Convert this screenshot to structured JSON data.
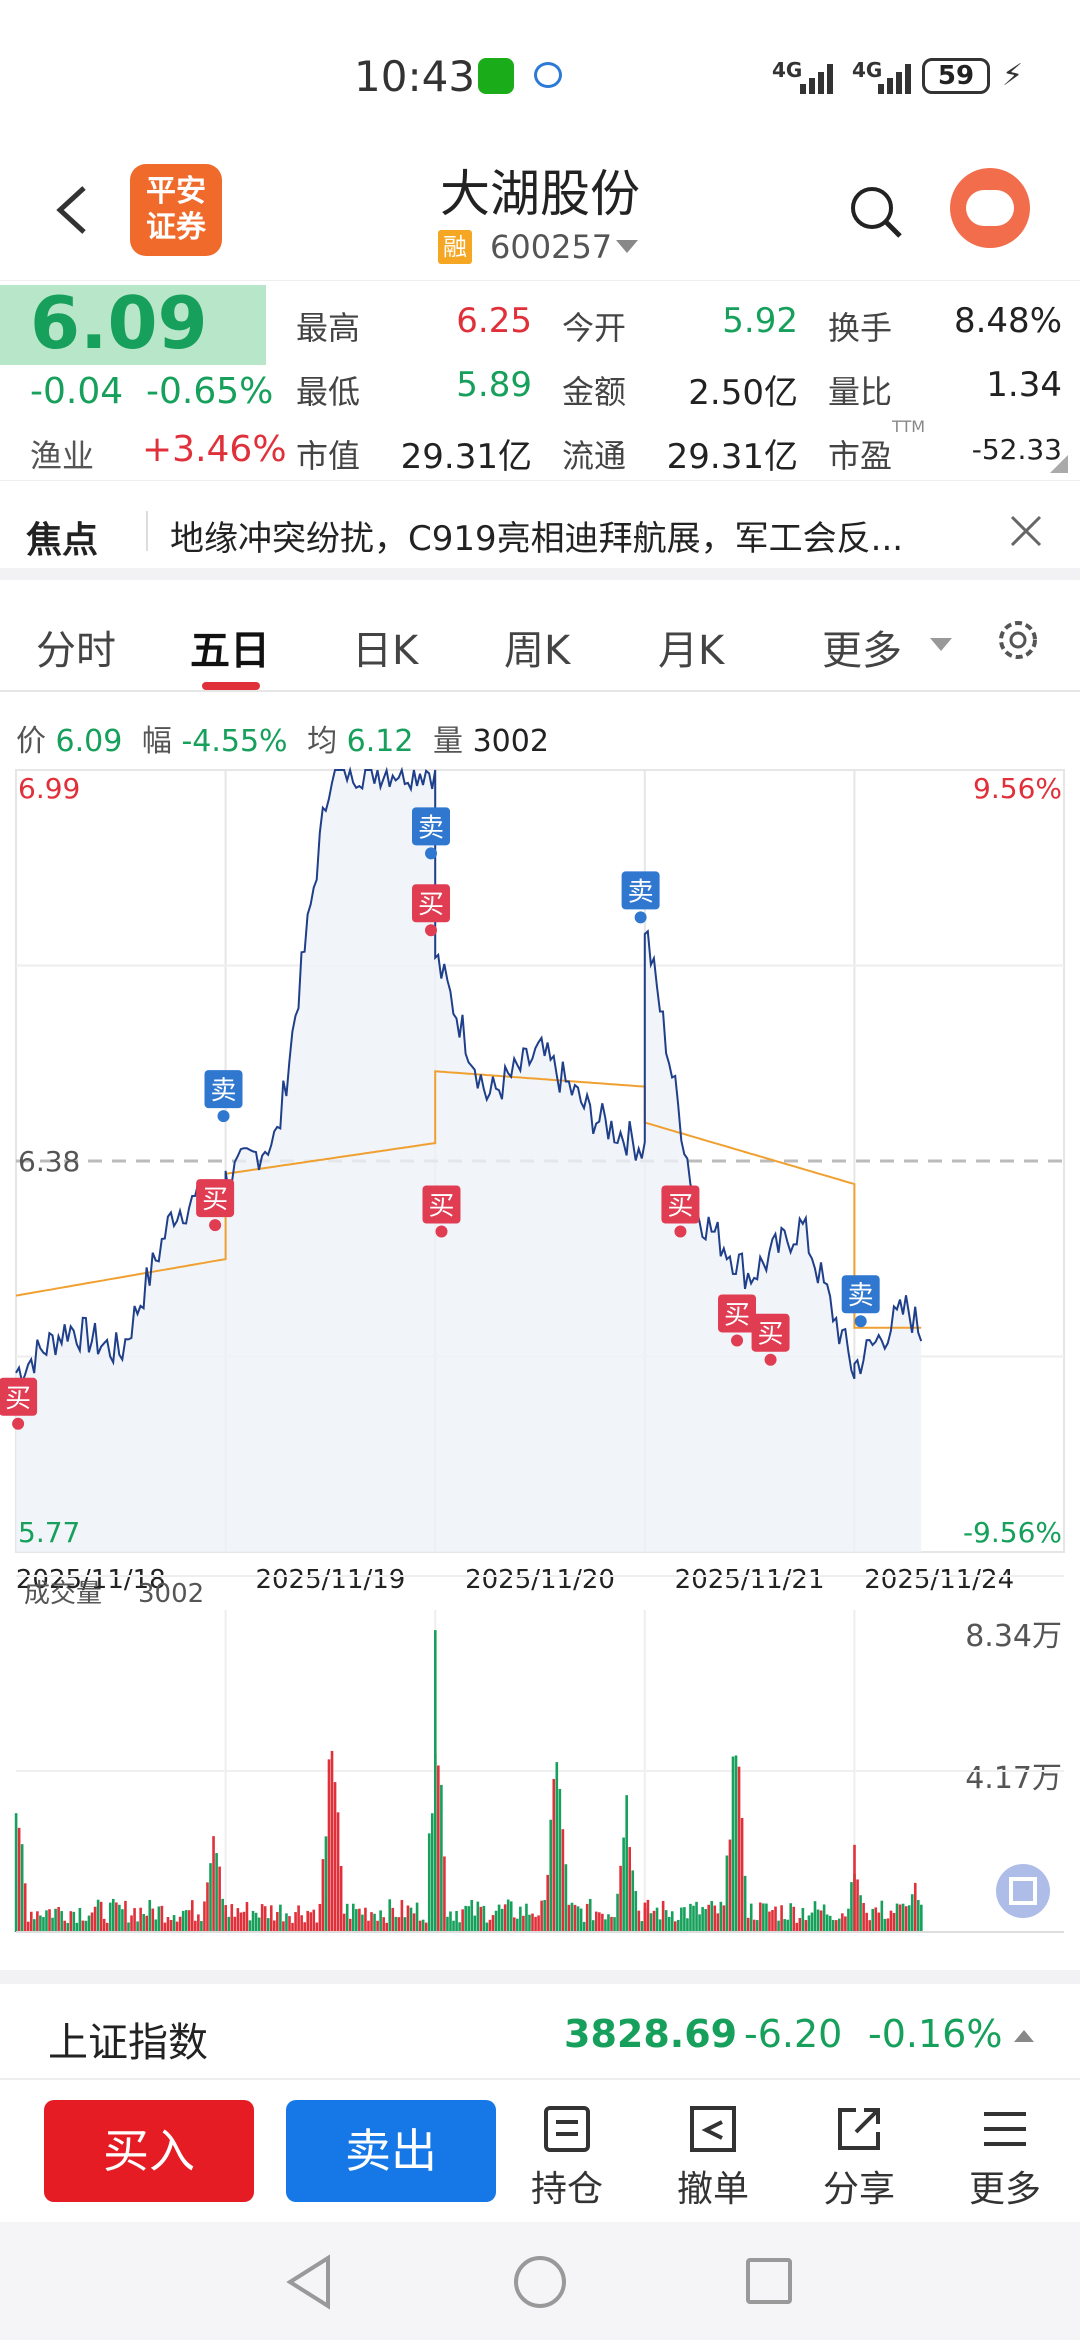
{
  "status_bar": {
    "time": "10:43",
    "battery": "59",
    "net1": "4G",
    "net2": "4G"
  },
  "header": {
    "broker_logo": "平安\n证券",
    "broker_line1": "平安",
    "broker_line2": "证券",
    "stock_name": "大湖股份",
    "margin_badge": "融",
    "stock_code": "600257"
  },
  "quote": {
    "price": "6.09",
    "change": "-0.04",
    "change_pct": "-0.65%",
    "sector": "渔业",
    "sector_pct": "+3.46%",
    "high_label": "最高",
    "high": "6.25",
    "open_label": "今开",
    "open": "5.92",
    "turnover_label": "换手",
    "turnover": "8.48%",
    "low_label": "最低",
    "low": "5.89",
    "amount_label": "金额",
    "amount": "2.50亿",
    "vol_ratio_label": "量比",
    "vol_ratio": "1.34",
    "mcap_label": "市值",
    "mcap": "29.31亿",
    "float_label": "流通",
    "float": "29.31亿",
    "pe_label": "市盈",
    "pe_sup": "TTM",
    "pe": "-52.33"
  },
  "news": {
    "label": "焦点",
    "text": "地缘冲突纷扰，C919亮相迪拜航展，军工会反..."
  },
  "tabs": {
    "t1": "分时",
    "t2": "五日",
    "t3": "日K",
    "t4": "周K",
    "t5": "月K",
    "more": "更多"
  },
  "info_line": {
    "price_label": "价",
    "price": "6.09",
    "range_label": "幅",
    "range": "-4.55%",
    "avg_label": "均",
    "avg": "6.12",
    "vol_label": "量",
    "vol": "3002"
  },
  "chart": {
    "y_max": "6.99",
    "y_mid": "6.38",
    "y_min": "5.77",
    "pct_max": "9.56%",
    "pct_min": "-9.56%",
    "dates": [
      "2025/11/18",
      "2025/11/19",
      "2025/11/20",
      "2025/11/21",
      "2025/11/24"
    ],
    "volume_label": "成交量",
    "volume_val": "3002",
    "vol_max": "8.34万",
    "vol_mid": "4.17万",
    "buy_tag": "买",
    "sell_tag": "卖"
  },
  "colors": {
    "up": "#e0313b",
    "down": "#16a05b",
    "price_line": "#1f3f8a",
    "avg_line": "#f0a030",
    "buy_btn": "#e51c23",
    "sell_btn": "#1677e6"
  },
  "chart_data": {
    "type": "line",
    "title": "",
    "x": [
      "2025/11/18",
      "2025/11/19",
      "2025/11/20",
      "2025/11/21",
      "2025/11/24"
    ],
    "series": [
      {
        "values": [
          6.05,
          6.28,
          6.95,
          6.52,
          6.25
        ]
      },
      {
        "values": [
          6.17,
          6.36,
          6.52,
          6.44,
          6.12
        ]
      }
    ],
    "ylim": [
      5.77,
      6.99
    ],
    "reference": 6.38,
    "markers": [
      {
        "x": "2025/11/18",
        "type": "买"
      },
      {
        "x": "2025/11/18",
        "type": "买"
      },
      {
        "x": "2025/11/18",
        "type": "卖"
      },
      {
        "x": "2025/11/19",
        "type": "卖"
      },
      {
        "x": "2025/11/19",
        "type": "买"
      },
      {
        "x": "2025/11/19",
        "type": "买"
      },
      {
        "x": "2025/11/20",
        "type": "卖"
      },
      {
        "x": "2025/11/20",
        "type": "买"
      },
      {
        "x": "2025/11/20",
        "type": "买"
      },
      {
        "x": "2025/11/20",
        "type": "买"
      },
      {
        "x": "2025/11/21",
        "type": "卖"
      }
    ]
  },
  "index": {
    "name": "上证指数",
    "value": "3828.69",
    "change": "-6.20",
    "pct": "-0.16%"
  },
  "bottom": {
    "buy": "买入",
    "sell": "卖出",
    "hold": "持仓",
    "cancel": "撤单",
    "share": "分享",
    "more": "更多"
  }
}
